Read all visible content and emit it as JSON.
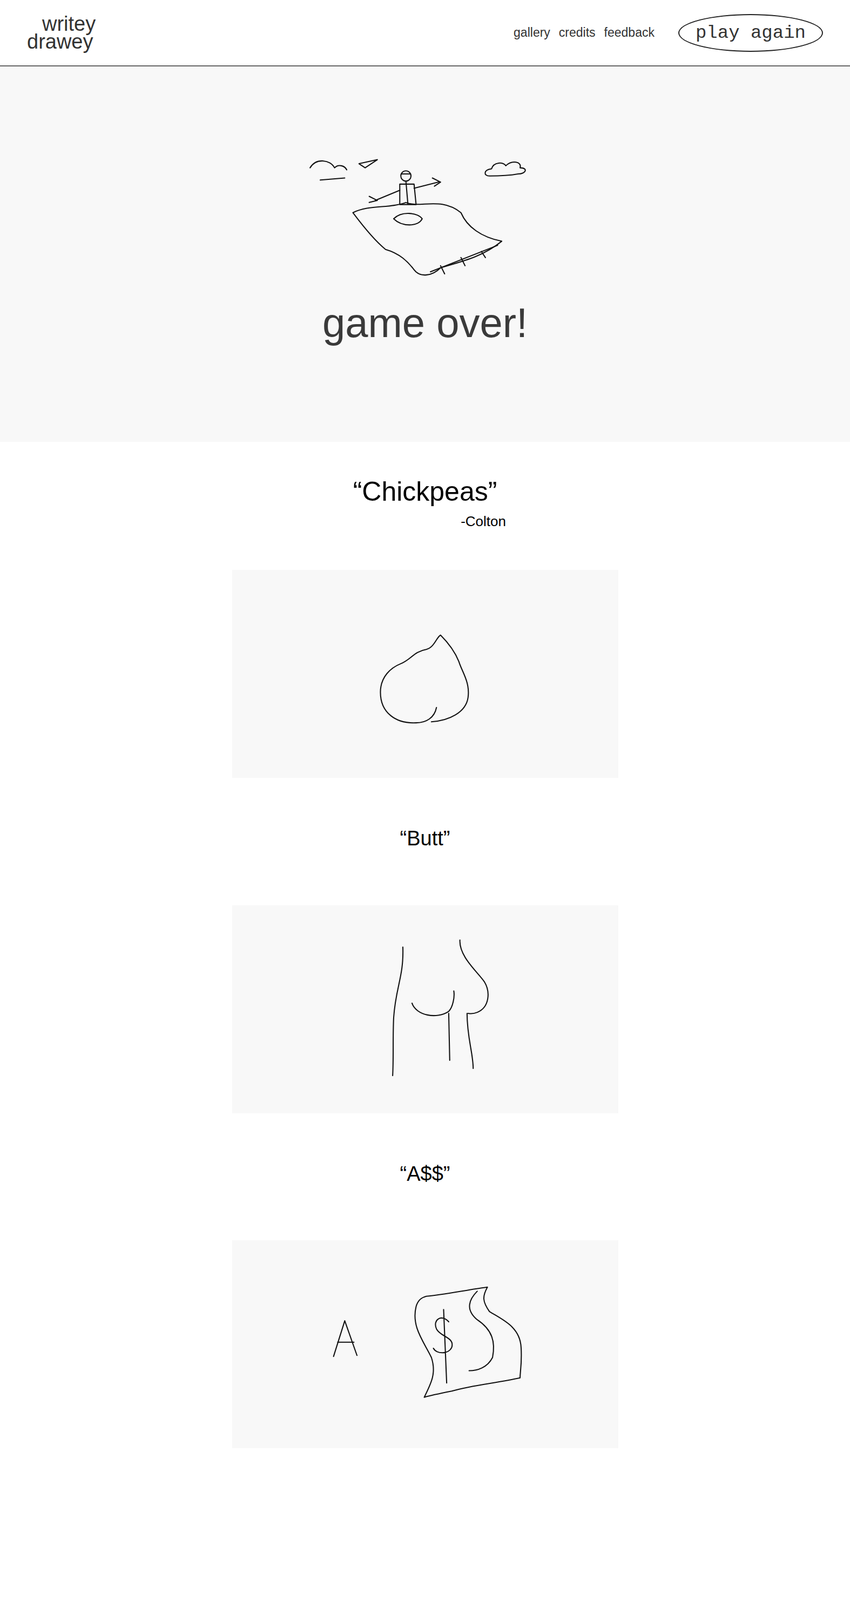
{
  "header": {
    "logo": [
      "writey",
      "drawey"
    ],
    "nav": [
      "gallery",
      "credits",
      "feedback"
    ],
    "button": "play again"
  },
  "hero": {
    "title": "game over!"
  },
  "rounds": [
    {
      "kind": "prompt",
      "text": "“Chickpeas”",
      "author": "-Colton"
    },
    {
      "kind": "drawing"
    },
    {
      "kind": "guess",
      "text": "“Butt”"
    },
    {
      "kind": "drawing"
    },
    {
      "kind": "guess",
      "text": "“A$$”"
    },
    {
      "kind": "drawing"
    }
  ]
}
